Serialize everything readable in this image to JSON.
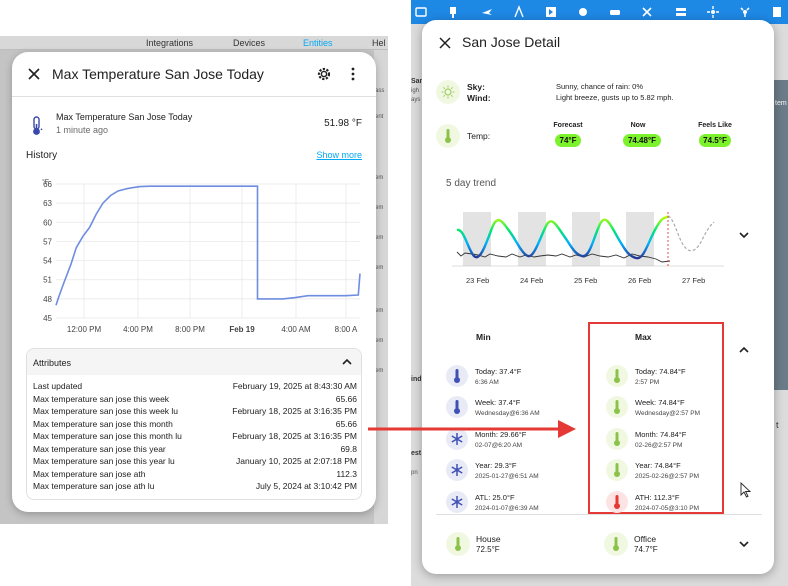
{
  "left_panel": {
    "nav": [
      "Integrations",
      "Devices",
      "Entities",
      "Hel"
    ],
    "right_col_labels": [
      "ass",
      "ent",
      "em",
      "em",
      "em",
      "em",
      "em",
      "em",
      "em"
    ]
  },
  "left_dialog": {
    "title": "Max Temperature San Jose Today",
    "entity_name": "Max Temperature San Jose Today",
    "entity_time": "1 minute ago",
    "entity_value": "51.98 °F",
    "history_label": "History",
    "show_more": "Show more",
    "chart_data": {
      "type": "line",
      "ylabel": "°F",
      "ylim": [
        45,
        66
      ],
      "yticks": [
        "66",
        "63",
        "60",
        "57",
        "54",
        "51",
        "48",
        "45"
      ],
      "xticks": [
        "12:00 PM",
        "4:00 PM",
        "8:00 PM",
        "Feb 19",
        "4:00 AM",
        "8:00 A"
      ],
      "series": [
        {
          "x": [
            0,
            0.3,
            0.9,
            1.8,
            2.4,
            3.2,
            4,
            4.8,
            5.6,
            6.5,
            7.4,
            8.2,
            9.0,
            10.0,
            11.2,
            12.8,
            14.5,
            16,
            18,
            20,
            22,
            24.0,
            24.0,
            25.5,
            27,
            28.5,
            30,
            31.5,
            33,
            34.5,
            36.0,
            36.2
          ],
          "y": [
            47.0,
            48.2,
            50.4,
            53.5,
            56.0,
            57.8,
            59.2,
            61.3,
            63.0,
            64.2,
            64.9,
            65.2,
            65.4,
            65.6,
            65.66,
            65.66,
            65.66,
            65.66,
            65.66,
            65.66,
            65.66,
            65.66,
            48.0,
            48.0,
            48.0,
            48.2,
            48.5,
            48.5,
            48.5,
            48.5,
            48.6,
            51.98
          ]
        }
      ]
    },
    "attributes_title": "Attributes",
    "attributes": [
      {
        "key": "Last updated",
        "value": "February 19, 2025 at 8:43:30 AM"
      },
      {
        "key": "Max temperature san jose this week",
        "value": "65.66"
      },
      {
        "key": "Max temperature san jose this week lu",
        "value": "February 18, 2025 at 3:16:35 PM"
      },
      {
        "key": "Max temperature san jose this month",
        "value": "65.66"
      },
      {
        "key": "Max temperature san jose this month lu",
        "value": "February 18, 2025 at 3:16:35 PM"
      },
      {
        "key": "Max temperature san jose this year",
        "value": "69.8"
      },
      {
        "key": "Max temperature san jose this year lu",
        "value": "January 10, 2025 at 2:07:18 PM"
      },
      {
        "key": "Max temperature san jose ath",
        "value": "112.3"
      },
      {
        "key": "Max temperature san jose ath lu",
        "value": "July 5, 2024 at 3:10:42 PM"
      }
    ]
  },
  "right_panel": {
    "bg_labels": [
      "San",
      "igh",
      "ays",
      "ind",
      "est",
      "pn",
      "tem",
      "t"
    ]
  },
  "right_dialog": {
    "title": "San Jose Detail",
    "sky_label": "Sky:",
    "wind_label": "Wind:",
    "sky_value": "Sunny, chance of rain: 0%",
    "wind_value": "Light breeze, gusts up to 5.82 mph.",
    "temp_label": "Temp:",
    "forecast_head": "Forecast",
    "now_head": "Now",
    "feels_head": "Feels Like",
    "forecast_value": "74°F",
    "now_value": "74.48°F",
    "feels_value": "74.5°F",
    "trend_title": "5 day trend",
    "trend_days": [
      "23 Feb",
      "24 Feb",
      "25 Feb",
      "26 Feb",
      "27 Feb"
    ],
    "min_head": "Min",
    "max_head": "Max",
    "min_items": [
      {
        "title": "Today: 37.4°F",
        "sub": "6:36 AM"
      },
      {
        "title": "Week: 37.4°F",
        "sub": "Wednesday@6:36 AM"
      },
      {
        "title": "Month: 29.66°F",
        "sub": "02-07@6:20 AM"
      },
      {
        "title": "Year: 29.3°F",
        "sub": "2025-01-27@6:51 AM"
      },
      {
        "title": "ATL: 25.0°F",
        "sub": "2024-01-07@6:39 AM"
      }
    ],
    "max_items": [
      {
        "title": "Today: 74.84°F",
        "sub": "2:57 PM"
      },
      {
        "title": "Week: 74.84°F",
        "sub": "Wednesday@2:57 PM"
      },
      {
        "title": "Month: 74.84°F",
        "sub": "02-26@2:57 PM"
      },
      {
        "title": "Year: 74.84°F",
        "sub": "2025-02-26@2:57 PM"
      },
      {
        "title": "ATH: 112.3°F",
        "sub": "2024-07-05@3:10 PM"
      }
    ],
    "house_label": "House",
    "house_value": "72.5°F",
    "office_label": "Office",
    "office_value": "74.7°F"
  },
  "colors": {
    "accent_blue": "#1e88e5",
    "link_blue": "#03a9f4",
    "chart_line": "#6f8de0",
    "pill_green": "#7cf22d",
    "highlight_red": "#e53935",
    "cold_purple": "#3f51b5",
    "hot_red": "#e53935"
  }
}
